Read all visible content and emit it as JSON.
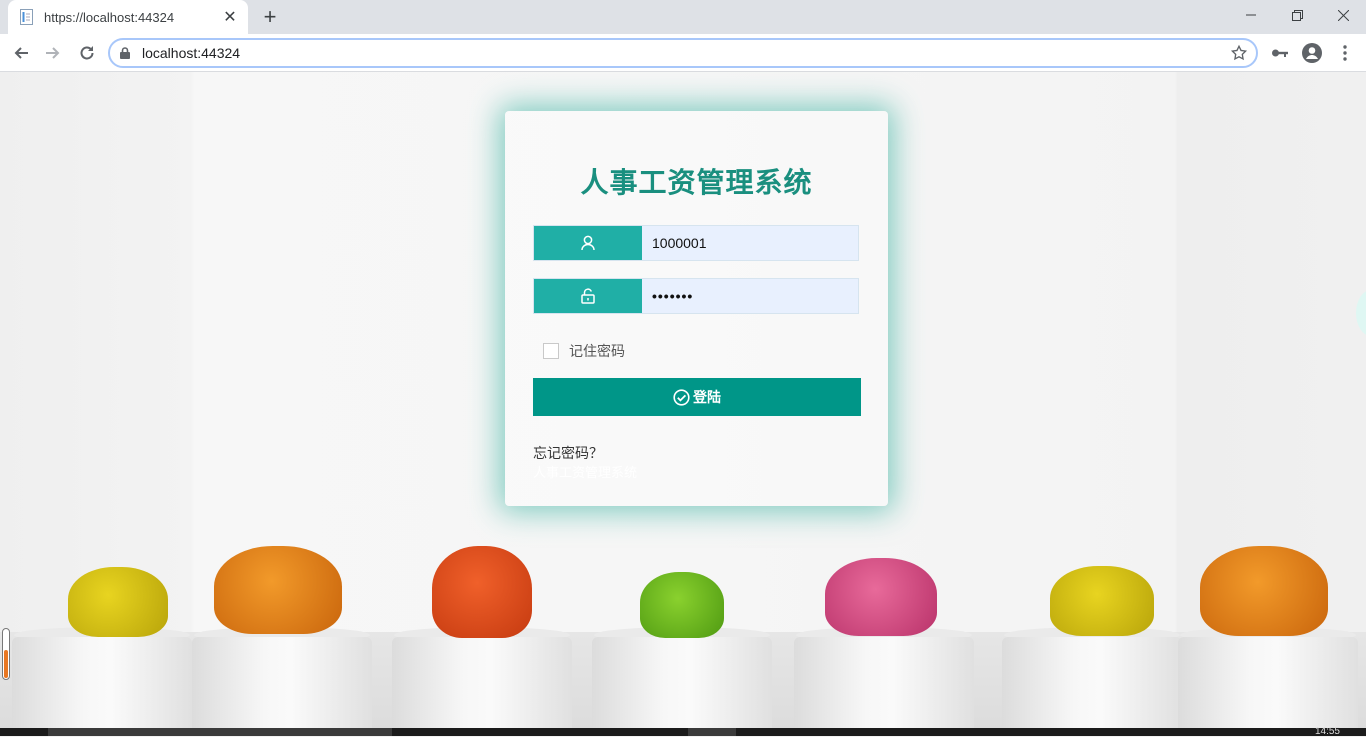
{
  "browser": {
    "tab_title": "https://localhost:44324",
    "url": "localhost:44324",
    "new_tab_label": "+"
  },
  "login": {
    "title": "人事工资管理系统",
    "username_value": "1000001",
    "password_value": "•••••••",
    "remember_label": "记住密码",
    "remember_checked": false,
    "login_button_label": "登陆",
    "forgot_link": "忘记密码？",
    "footer_text": "人事工资管理系统"
  },
  "taskbar": {
    "time": "14:55"
  },
  "colors": {
    "accent_teal": "#20afa6",
    "button_teal": "#009688",
    "title_teal": "#1a8f7f"
  },
  "icons": [
    "user-icon",
    "unlock-icon",
    "check-circle-icon",
    "lock-icon",
    "star-icon",
    "key-icon",
    "account-icon",
    "menu-icon"
  ]
}
